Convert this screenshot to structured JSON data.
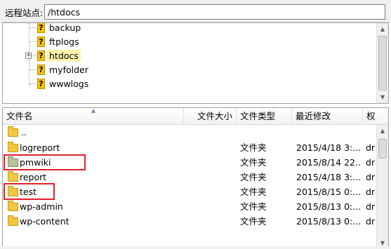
{
  "site_bar": {
    "label": "远程站点:",
    "path": "/htdocs"
  },
  "tree": {
    "items": [
      {
        "label": "backup",
        "icon": "unknown-folder-icon",
        "expandable": false,
        "selected": false
      },
      {
        "label": "ftplogs",
        "icon": "unknown-folder-icon",
        "expandable": false,
        "selected": false
      },
      {
        "label": "htdocs",
        "icon": "unknown-folder-icon",
        "expandable": true,
        "expander": "+",
        "selected": true
      },
      {
        "label": "myfolder",
        "icon": "unknown-folder-icon",
        "expandable": false,
        "selected": false
      },
      {
        "label": "wwwlogs",
        "icon": "unknown-folder-icon",
        "expandable": false,
        "selected": false
      }
    ]
  },
  "file_list": {
    "columns": [
      "文件名",
      "文件大小",
      "文件类型",
      "最近修改",
      "权"
    ],
    "rows": [
      {
        "name": "..",
        "size": "",
        "type": "",
        "modified": "",
        "perm": "",
        "icon": "folder-icon",
        "highlight": false
      },
      {
        "name": "logreport",
        "size": "",
        "type": "文件夹",
        "modified": "2015/4/18 3:...",
        "perm": "dr",
        "icon": "folder-icon",
        "highlight": false
      },
      {
        "name": "pmwiki",
        "size": "",
        "type": "文件夹",
        "modified": "2015/8/14 22...",
        "perm": "dr",
        "icon": "folder-green-icon",
        "highlight": true
      },
      {
        "name": "report",
        "size": "",
        "type": "文件夹",
        "modified": "2015/4/18 3:...",
        "perm": "dr",
        "icon": "folder-icon",
        "highlight": false
      },
      {
        "name": "test",
        "size": "",
        "type": "文件夹",
        "modified": "2015/8/15 0:...",
        "perm": "dr",
        "icon": "folder-icon",
        "highlight": true
      },
      {
        "name": "wp-admin",
        "size": "",
        "type": "文件夹",
        "modified": "2015/8/13 0:...",
        "perm": "dr",
        "icon": "folder-icon",
        "highlight": false
      },
      {
        "name": "wp-content",
        "size": "",
        "type": "文件夹",
        "modified": "2015/8/13 0:...",
        "perm": "dr",
        "icon": "folder-icon",
        "highlight": false
      }
    ]
  },
  "colors": {
    "highlight_border": "#e0202a",
    "selected_bg": "#fff3b0",
    "folder": "#f3c640",
    "folder_green": "#b9c39a"
  }
}
